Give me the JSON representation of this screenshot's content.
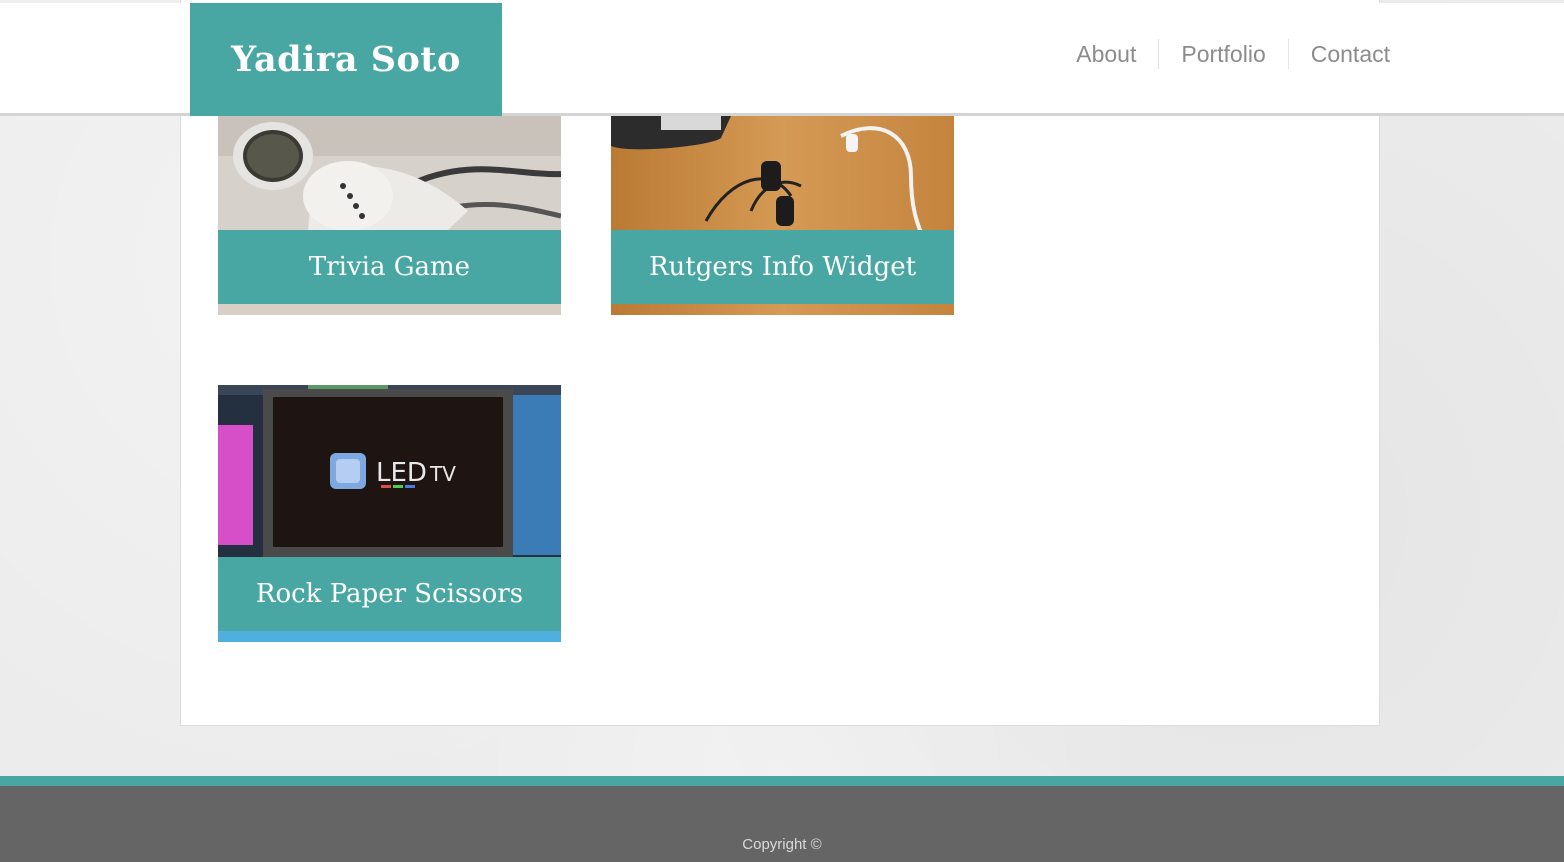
{
  "header": {
    "brand": "Yadira Soto",
    "nav": [
      "About",
      "Portfolio",
      "Contact"
    ]
  },
  "portfolio": {
    "items": [
      {
        "title": "Trivia Game",
        "image": "earbuds-photo"
      },
      {
        "title": "Rutgers Info Widget",
        "image": "phone-earbuds-desk-photo"
      },
      {
        "title": "Rock Paper Scissors",
        "image": "led-tv-photo"
      }
    ]
  },
  "footer": {
    "copyright": "Copyright ©"
  },
  "colors": {
    "accent": "#48a7a2",
    "footer_bg": "#656565",
    "nav_text": "#8c8c8c"
  }
}
